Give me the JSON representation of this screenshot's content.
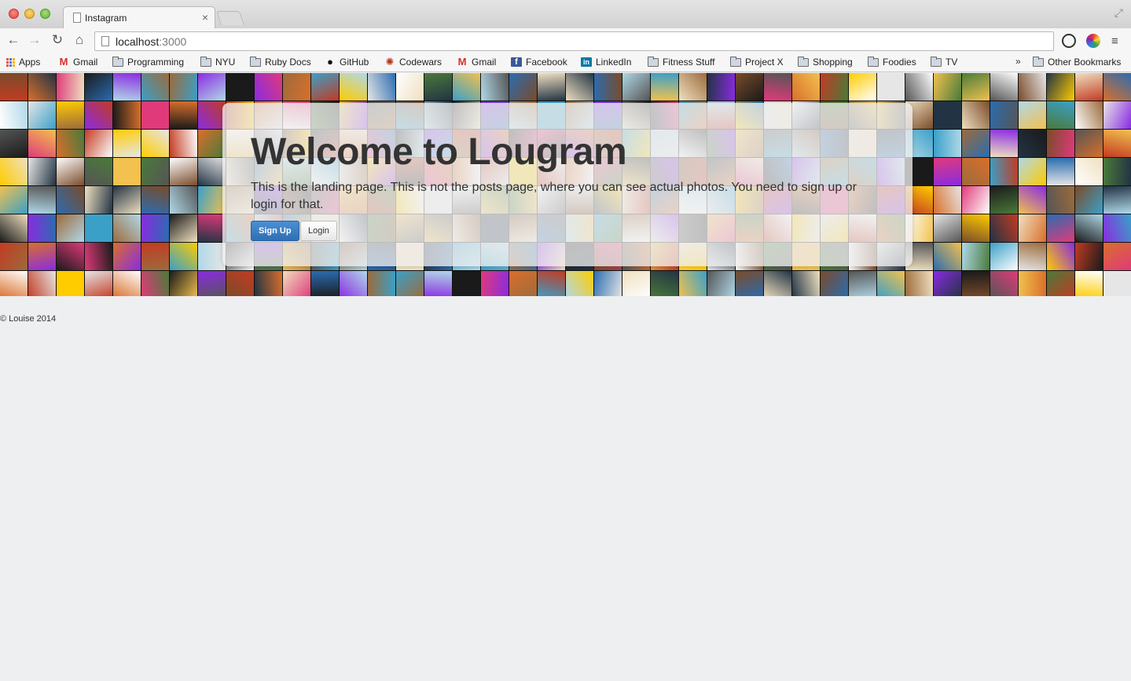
{
  "browser": {
    "tab_title": "Instagram",
    "tab_close": "×",
    "url_host": "localhost",
    "url_port": ":3000",
    "nav": {
      "back": "←",
      "forward": "→",
      "reload": "↻",
      "home": "⌂",
      "menu": "≡"
    }
  },
  "bookmarks": {
    "items": [
      {
        "label": "Apps",
        "icon": "apps-grid-icon"
      },
      {
        "label": "Gmail",
        "icon": "gmail-icon"
      },
      {
        "label": "Programming",
        "icon": "folder-icon"
      },
      {
        "label": "NYU",
        "icon": "folder-icon"
      },
      {
        "label": "Ruby Docs",
        "icon": "folder-icon"
      },
      {
        "label": "GitHub",
        "icon": "github-icon"
      },
      {
        "label": "Codewars",
        "icon": "codewars-icon"
      },
      {
        "label": "Gmail",
        "icon": "gmail-icon"
      },
      {
        "label": "Facebook",
        "icon": "facebook-icon"
      },
      {
        "label": "LinkedIn",
        "icon": "linkedin-icon"
      },
      {
        "label": "Fitness Stuff",
        "icon": "folder-icon"
      },
      {
        "label": "Project X",
        "icon": "folder-icon"
      },
      {
        "label": "Shopping",
        "icon": "folder-icon"
      },
      {
        "label": "Foodies",
        "icon": "folder-icon"
      },
      {
        "label": "TV",
        "icon": "folder-icon"
      }
    ],
    "more": "»",
    "other": "Other Bookmarks"
  },
  "hero": {
    "title": "Welcome to Lougram",
    "text": "This is the landing page. This is not the posts page, where you can see actual photos. You need to sign up or login for that.",
    "signup_label": "Sign Up",
    "login_label": "Login"
  },
  "footer": {
    "text": "© Louise 2014"
  },
  "colors": {
    "primary_button": "#337ab7",
    "page_background": "#eeeff1",
    "mosaic_palette": [
      "#c23b22",
      "#f2c14e",
      "#2b6cb0",
      "#1a1a1a",
      "#e6e6e6",
      "#7a4b2a",
      "#3aa0c8",
      "#d96f2b",
      "#4a7a3a",
      "#efe0c0",
      "#8a2be2",
      "#ffcc00",
      "#555555",
      "#b0d8e8",
      "#e03a7a",
      "#ffffff",
      "#223344",
      "#9c6b3c"
    ]
  }
}
